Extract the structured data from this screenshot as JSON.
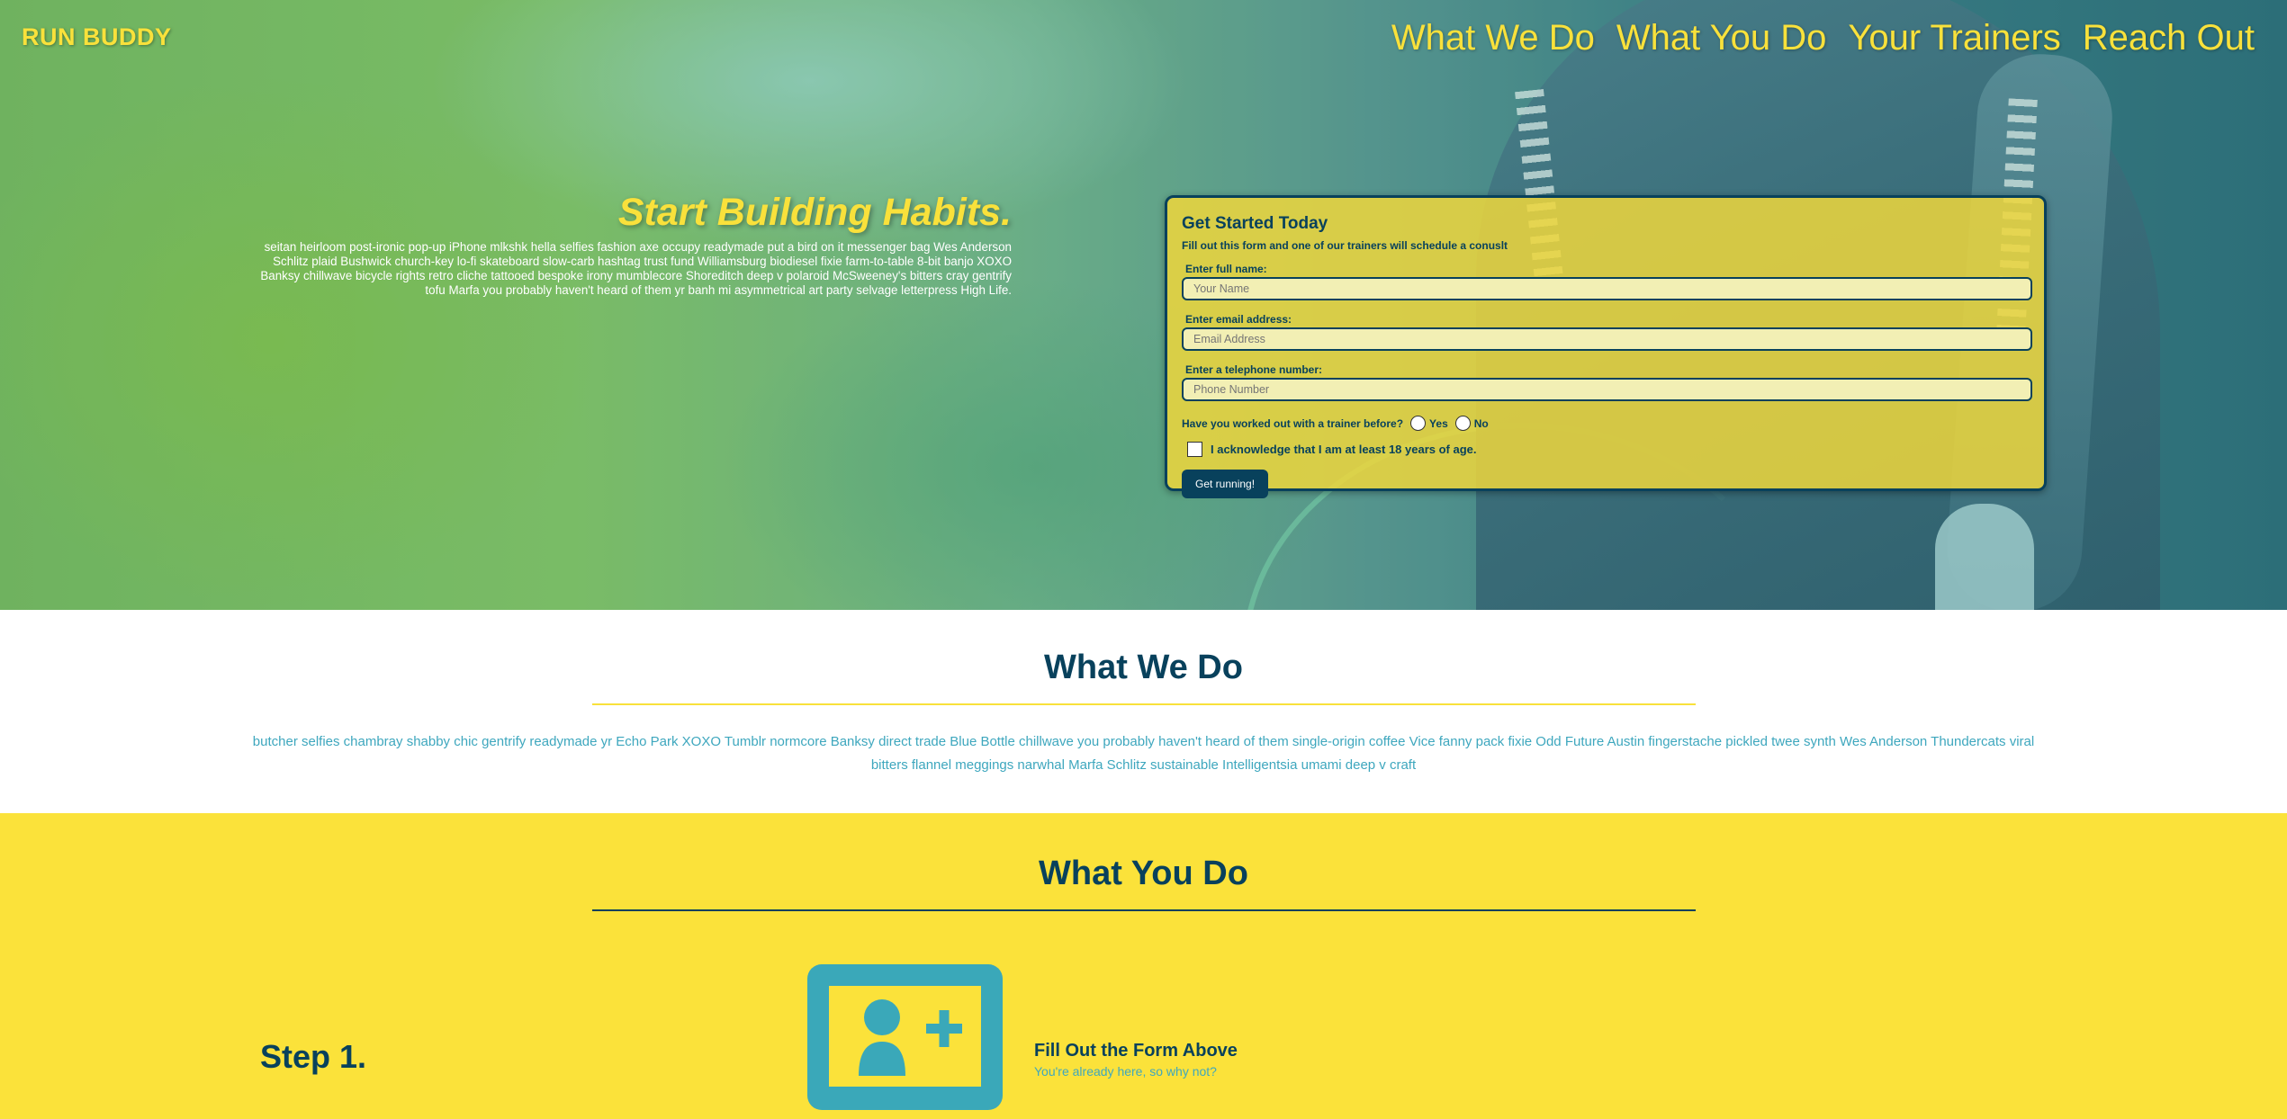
{
  "header": {
    "brand": "RUN BUDDY",
    "nav": [
      "What We Do",
      "What You Do",
      "Your Trainers",
      "Reach Out"
    ]
  },
  "hero": {
    "title": "Start Building Habits.",
    "body": "seitan heirloom post-ironic pop-up iPhone mlkshk hella selfies fashion axe occupy readymade put a bird on it messenger bag Wes Anderson Schlitz plaid Bushwick church-key lo-fi skateboard slow-carb hashtag trust fund Williamsburg biodiesel fixie farm-to-table 8-bit banjo XOXO Banksy chillwave bicycle rights retro cliche tattooed bespoke irony mumblecore Shoreditch deep v polaroid McSweeney's bitters cray gentrify tofu Marfa you probably haven't heard of them yr banh mi asymmetrical art party selvage letterpress High Life."
  },
  "form": {
    "title": "Get Started Today",
    "subtitle": "Fill out this form and one of our trainers will schedule a conuslt",
    "name_label": "Enter full name:",
    "name_placeholder": "Your Name",
    "email_label": "Enter email address:",
    "email_placeholder": "Email Address",
    "phone_label": "Enter a telephone number:",
    "phone_placeholder": "Phone Number",
    "trainer_question": "Have you worked out with a trainer before?",
    "yes_label": "Yes",
    "no_label": "No",
    "acknowledge_label": "I acknowledge that I am at least 18 years of age.",
    "submit_label": "Get running!"
  },
  "what_we_do": {
    "title": "What We Do",
    "body": "butcher selfies chambray shabby chic gentrify readymade yr Echo Park XOXO Tumblr normcore Banksy direct trade Blue Bottle chillwave you probably haven't heard of them single-origin coffee Vice fanny pack fixie Odd Future Austin fingerstache pickled twee synth Wes Anderson Thundercats viral bitters flannel meggings narwhal Marfa Schlitz sustainable Intelligentsia umami deep v craft"
  },
  "what_you_do": {
    "title": "What You Do",
    "step_label": "Step 1.",
    "step_heading": "Fill Out the Form Above",
    "step_sub": "You're already here, so why not?",
    "step_icon": "add-user-icon"
  },
  "colors": {
    "brand_yellow": "#f9e13b",
    "navy": "#08415c",
    "teal": "#3ea7be"
  }
}
